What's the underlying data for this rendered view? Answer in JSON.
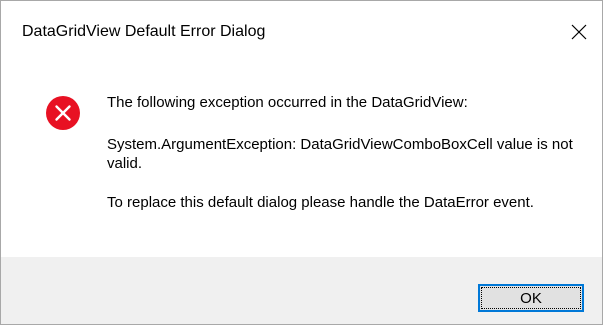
{
  "window": {
    "title": "DataGridView Default Error Dialog",
    "close_icon": "close-icon"
  },
  "message": {
    "icon": "error-icon",
    "line1": "The following exception occurred in the DataGridView:",
    "line2": "System.ArgumentException: DataGridViewComboBoxCell value is not valid.",
    "line3": "To replace this default dialog please handle the DataError event."
  },
  "buttons": {
    "ok_label": "OK"
  },
  "colors": {
    "error_red": "#e81123",
    "focus_border": "#0078d7",
    "footer_bg": "#f0f0f0"
  }
}
